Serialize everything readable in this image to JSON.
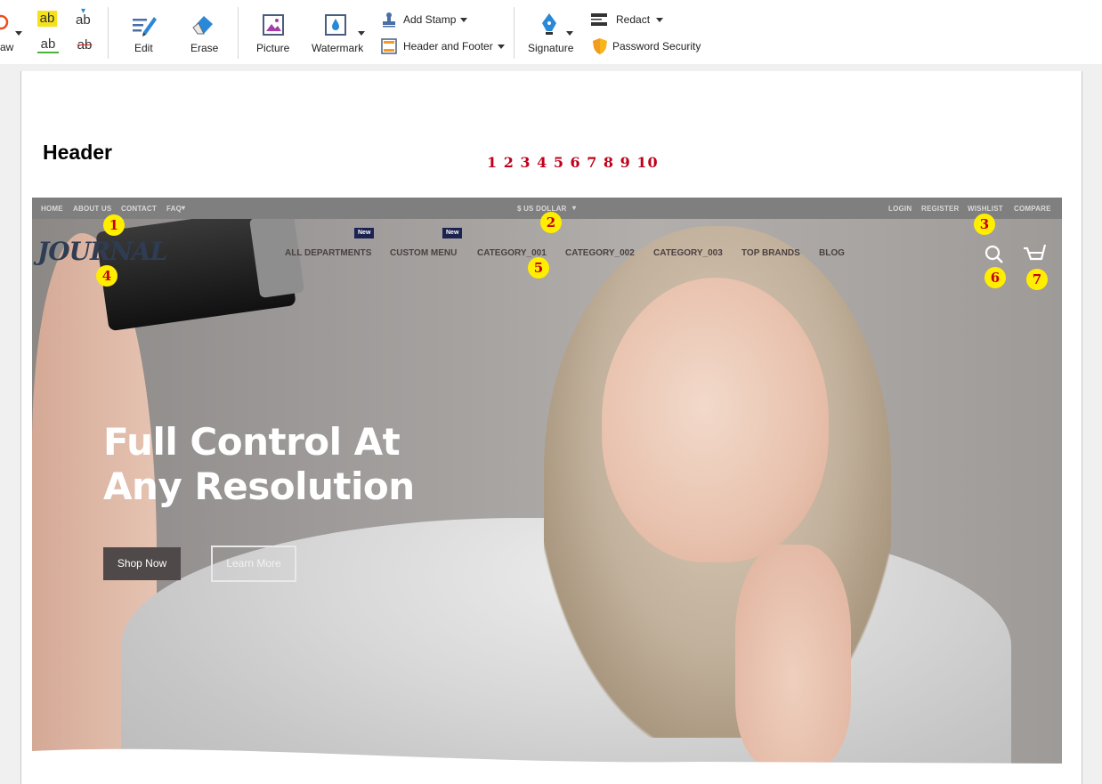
{
  "toolbar": {
    "draw_label": "aw",
    "edit_label": "Edit",
    "erase_label": "Erase",
    "picture_label": "Picture",
    "watermark_label": "Watermark",
    "add_stamp_label": "Add Stamp",
    "header_footer_label": "Header and Footer",
    "signature_label": "Signature",
    "redact_label": "Redact",
    "password_security_label": "Password Security",
    "highlight_text_label": "ab",
    "insert_text_label": "ab",
    "underline_text_label": "ab",
    "strikeout_text_label": "ab"
  },
  "document": {
    "heading": "Header",
    "number_sequence": "1 2 3 4 5 6 7 8 9 10"
  },
  "site": {
    "topbar_left": [
      "HOME",
      "ABOUT US",
      "CONTACT",
      "FAQ"
    ],
    "currency": "$ US DOLLAR",
    "topbar_right": [
      "LOGIN",
      "REGISTER",
      "WISHLIST",
      "COMPARE"
    ],
    "logo": "JOURNAL",
    "menu": [
      "ALL DEPARTMENTS",
      "CUSTOM MENU",
      "CATEGORY_001",
      "CATEGORY_002",
      "CATEGORY_003",
      "TOP BRANDS",
      "BLOG"
    ],
    "new_badge": "New",
    "hero_line1": "Full Control At",
    "hero_line2": "Any Resolution",
    "shop_now": "Shop Now",
    "learn_more": "Learn More"
  },
  "markers": [
    "1",
    "2",
    "3",
    "4",
    "5",
    "6",
    "7"
  ],
  "colors": {
    "marker_fill": "#ffee00",
    "marker_text": "#c40017",
    "topbar_bg": "#7f7f7f",
    "new_badge_bg": "#1c2350"
  }
}
